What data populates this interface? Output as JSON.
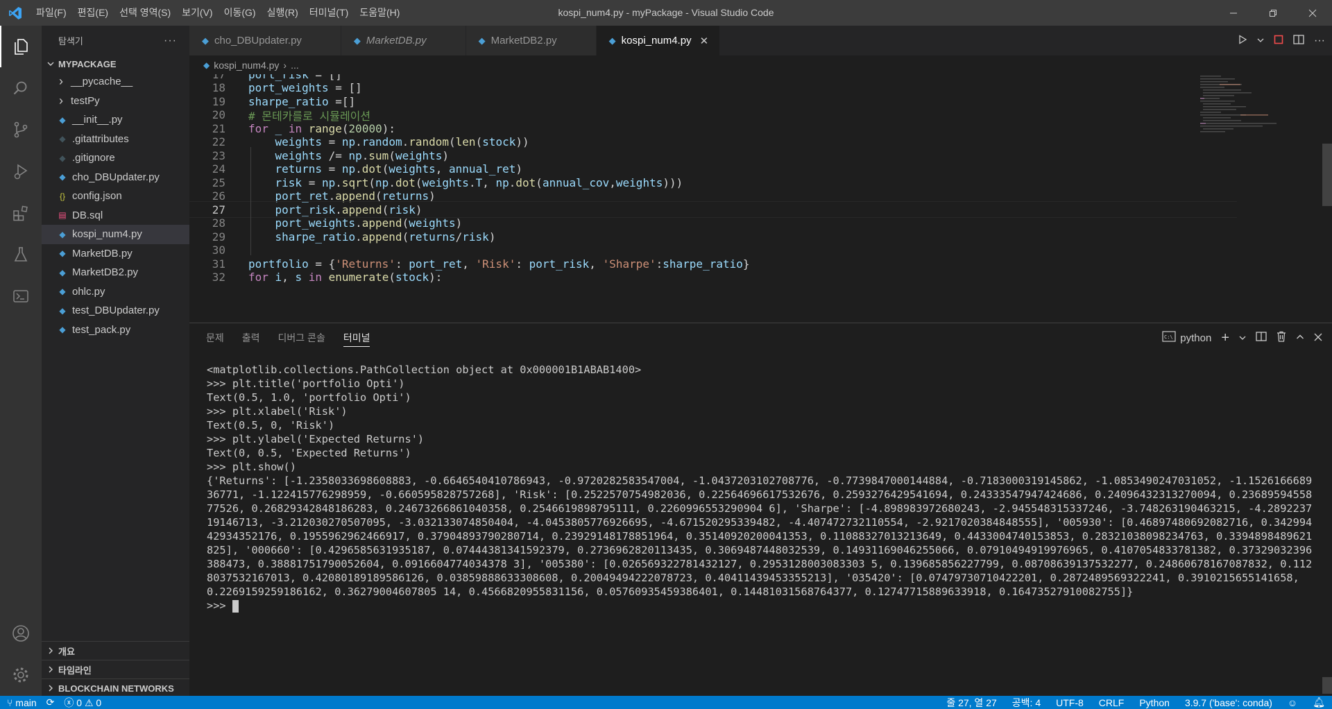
{
  "window": {
    "title": "kospi_num4.py - myPackage - Visual Studio Code",
    "menu": [
      "파일(F)",
      "편집(E)",
      "선택 영역(S)",
      "보기(V)",
      "이동(G)",
      "실행(R)",
      "터미널(T)",
      "도움말(H)"
    ]
  },
  "sidebar": {
    "title": "탐색기",
    "root": "MYPACKAGE",
    "items": [
      {
        "label": "__pycache__",
        "type": "folder"
      },
      {
        "label": "testPy",
        "type": "folder"
      },
      {
        "label": "__init__.py",
        "type": "python"
      },
      {
        "label": ".gitattributes",
        "type": "git"
      },
      {
        "label": ".gitignore",
        "type": "git"
      },
      {
        "label": "cho_DBUpdater.py",
        "type": "python"
      },
      {
        "label": "config.json",
        "type": "json"
      },
      {
        "label": "DB.sql",
        "type": "sql"
      },
      {
        "label": "kospi_num4.py",
        "type": "python",
        "selected": true
      },
      {
        "label": "MarketDB.py",
        "type": "python"
      },
      {
        "label": "MarketDB2.py",
        "type": "python"
      },
      {
        "label": "ohlc.py",
        "type": "python"
      },
      {
        "label": "test_DBUpdater.py",
        "type": "python"
      },
      {
        "label": "test_pack.py",
        "type": "python"
      }
    ],
    "sections": [
      "개요",
      "타임라인",
      "BLOCKCHAIN NETWORKS"
    ]
  },
  "tabs": [
    {
      "label": "cho_DBUpdater.py",
      "italic": false,
      "active": false
    },
    {
      "label": "MarketDB.py",
      "italic": true,
      "active": false
    },
    {
      "label": "MarketDB2.py",
      "italic": false,
      "active": false
    },
    {
      "label": "kospi_num4.py",
      "italic": false,
      "active": true
    }
  ],
  "breadcrumb": {
    "file": "kospi_num4.py",
    "rest": "..."
  },
  "editor": {
    "current_line": 27,
    "lines": [
      {
        "n": "17",
        "text": "port_risk = []"
      },
      {
        "n": "18",
        "text": "port_weights = []"
      },
      {
        "n": "19",
        "text": "sharpe_ratio =[]"
      },
      {
        "n": "20",
        "text": "# 몬테카를로 시뮬레이션"
      },
      {
        "n": "21",
        "text": "for _ in range(20000):"
      },
      {
        "n": "22",
        "text": "    weights = np.random.random(len(stock))"
      },
      {
        "n": "23",
        "text": "    weights /= np.sum(weights)"
      },
      {
        "n": "24",
        "text": "    returns = np.dot(weights, annual_ret)"
      },
      {
        "n": "25",
        "text": "    risk = np.sqrt(np.dot(weights.T, np.dot(annual_cov,weights)))"
      },
      {
        "n": "26",
        "text": "    port_ret.append(returns)"
      },
      {
        "n": "27",
        "text": "    port_risk.append(risk)"
      },
      {
        "n": "28",
        "text": "    port_weights.append(weights)"
      },
      {
        "n": "29",
        "text": "    sharpe_ratio.append(returns/risk)"
      },
      {
        "n": "30",
        "text": ""
      },
      {
        "n": "31",
        "text": "portfolio = {'Returns': port_ret, 'Risk': port_risk, 'Sharpe':sharpe_ratio}"
      },
      {
        "n": "32",
        "text": "for i, s in enumerate(stock):"
      }
    ]
  },
  "panel": {
    "tabs": [
      "문제",
      "출력",
      "디버그 콘솔",
      "터미널"
    ],
    "active_tab": "터미널",
    "terminal_name": "python",
    "lines": [
      "<matplotlib.collections.PathCollection object at 0x000001B1ABAB1400>",
      ">>> plt.title('portfolio Opti')",
      "Text(0.5, 1.0, 'portfolio Opti')",
      ">>> plt.xlabel('Risk')",
      "Text(0.5, 0, 'Risk')",
      ">>> plt.ylabel('Expected Returns')",
      "Text(0, 0.5, 'Expected Returns')",
      ">>> plt.show()"
    ],
    "output": "{'Returns': [-1.2358033698608883, -0.6646540410786943, -0.9720282583547004, -1.0437203102708776, -0.7739847000144884, -0.7183000319145862, -1.0853490247031052, -1.152616668936771, -1.122415776298959, -0.660595828757268], 'Risk': [0.2522570754982036, 0.22564696617532676, 0.2593276429541694, 0.24333547947424686, 0.24096432313270094, 0.2368959455877526, 0.26829342848186283, 0.24673266861040358, 0.2546619898795111, 0.2260996553290904 6], 'Sharpe': [-4.898983972680243, -2.945548315337246, -3.748263190463215, -4.289223719146713, -3.212030270507095, -3.032133074850404, -4.0453805776926695, -4.671520295339482, -4.407472732110554, -2.9217020384848555], '005930': [0.46897480692082716, 0.34299442934352176, 0.1955962962466917, 0.37904893790280714, 0.23929148178851964, 0.35140920200041353, 0.11088327013213649, 0.4433004740153853, 0.28321038098234763, 0.3394898489621825], '000660': [0.4296585631935187, 0.07444381341592379, 0.2736962820113435, 0.3069487448032539, 0.14931169046255066, 0.07910494919976965, 0.4107054833781382, 0.37329032396388473, 0.38881751790052604, 0.0916604774034378 3], '005380': [0.026569322781432127, 0.2953128003083303 5, 0.139685856227799, 0.08708639137532277, 0.24860678167087832, 0.1128037532167013, 0.42080189189586126, 0.03859888633308608, 0.20049494222078723, 0.40411439453355213], '035420': [0.07479730710422201, 0.2872489569322241, 0.3910215655141658, 0.2269159259186162, 0.36279004607805 14, 0.4566820955831156, 0.05760935459386401, 0.14481031568764377, 0.12747715889633918, 0.16473527910082755]}",
    "prompt": ">>>"
  },
  "status": {
    "branch": "main",
    "errors": "0",
    "warnings": "0",
    "position": "줄 27, 열 27",
    "spaces": "공백: 4",
    "encoding": "UTF-8",
    "eol": "CRLF",
    "language": "Python",
    "interpreter": "3.9.7 ('base': conda)"
  }
}
